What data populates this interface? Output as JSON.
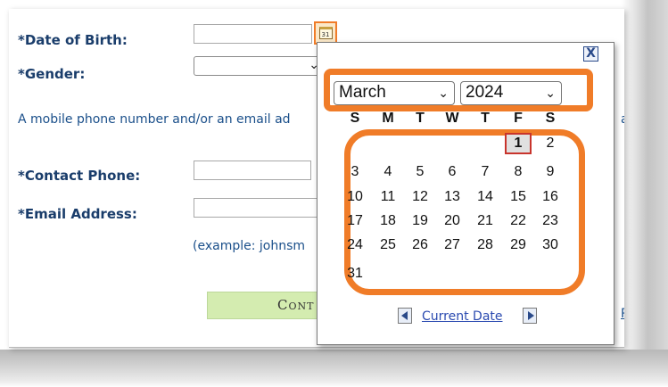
{
  "form": {
    "dob_label": "*Date of Birth:",
    "gender_label": "*Gender:",
    "info_text": "A mobile phone number and/or an email ad",
    "info_tail": "as",
    "contact_phone_label": "*Contact Phone:",
    "email_label": "*Email Address:",
    "example_text": "(example: johnsm",
    "continue_label": "Cont",
    "right_link_text": "P",
    "dob_value": "",
    "gender_value": "",
    "phone_value": "",
    "email_value": "",
    "calendar_icon_text": "31"
  },
  "calendar": {
    "close_label": "X",
    "month": "March",
    "year": "2024",
    "weekdays": [
      "S",
      "M",
      "T",
      "W",
      "T",
      "F",
      "S"
    ],
    "weeks": [
      [
        "",
        "",
        "",
        "",
        "",
        "1",
        "2"
      ],
      [
        "3",
        "4",
        "5",
        "6",
        "7",
        "8",
        "9"
      ],
      [
        "10",
        "11",
        "12",
        "13",
        "14",
        "15",
        "16"
      ],
      [
        "17",
        "18",
        "19",
        "20",
        "21",
        "22",
        "23"
      ],
      [
        "24",
        "25",
        "26",
        "27",
        "28",
        "29",
        "30"
      ],
      [
        "31",
        "",
        "",
        "",
        "",
        "",
        ""
      ]
    ],
    "selected_day": "1",
    "current_date_label": "Current Date"
  },
  "colors": {
    "highlight": "#f07c28",
    "label_text": "#1a3d6b",
    "link": "#2a4ab0",
    "button_bg": "#d4ecb0",
    "today_border": "#c8342c"
  }
}
